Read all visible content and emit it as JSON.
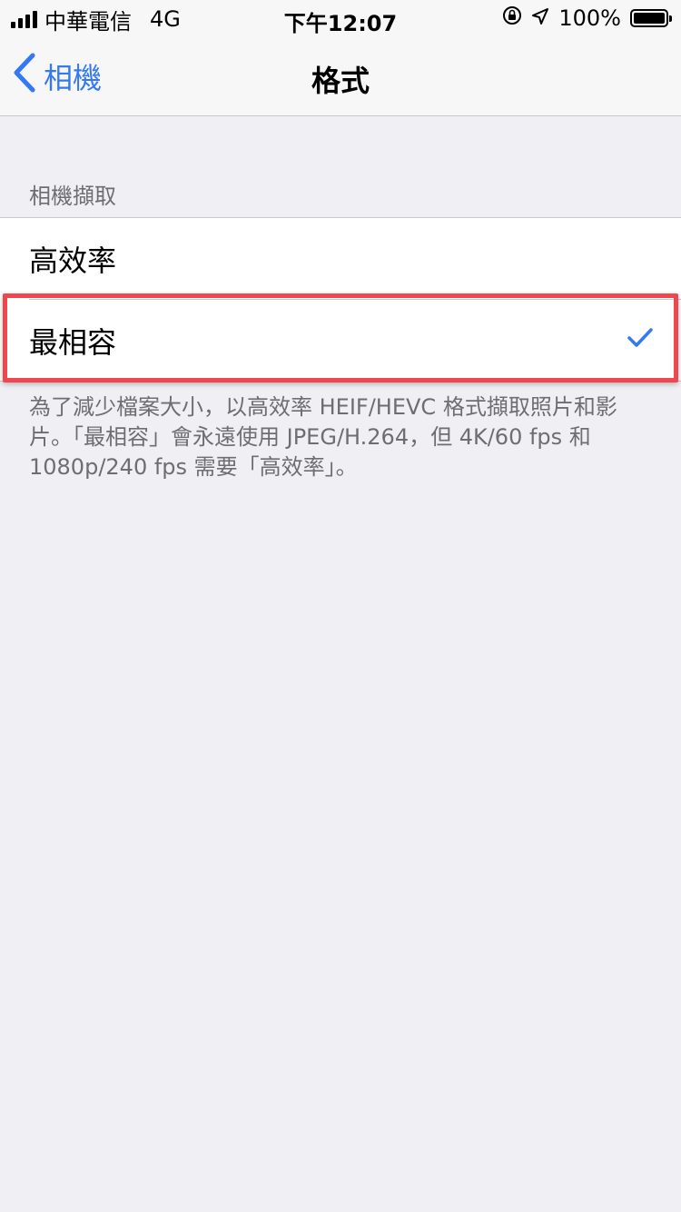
{
  "status_bar": {
    "carrier": "中華電信",
    "network": "4G",
    "time": "下午12:07",
    "battery": "100%",
    "battery_level": 1.0
  },
  "nav": {
    "back_label": "相機",
    "title": "格式"
  },
  "section": {
    "header": "相機擷取",
    "options": [
      {
        "label": "高效率",
        "selected": false
      },
      {
        "label": "最相容",
        "selected": true
      }
    ],
    "footer": "為了減少檔案大小，以高效率 HEIF/HEVC 格式擷取照片和影片。「最相容」會永遠使用 JPEG/H.264，但 4K/60 fps 和 1080p/240 fps 需要「高效率」。"
  },
  "colors": {
    "accent": "#3478f6",
    "highlight": "#f0474f",
    "background": "#efeff4"
  },
  "icons": {
    "back": "chevron-left-icon",
    "check": "checkmark-icon",
    "orientation_lock": "orientation-lock-icon",
    "location": "location-arrow-icon"
  }
}
